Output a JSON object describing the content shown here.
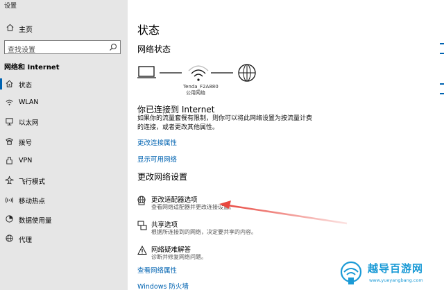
{
  "window": {
    "title": "设置"
  },
  "sidebar": {
    "home_label": "主页",
    "search_placeholder": "查找设置",
    "section_title": "网络和 Internet",
    "items": [
      {
        "label": "状态",
        "icon": "home-network-icon",
        "active": true
      },
      {
        "label": "WLAN",
        "icon": "wifi-icon",
        "active": false
      },
      {
        "label": "以太网",
        "icon": "ethernet-icon",
        "active": false
      },
      {
        "label": "拨号",
        "icon": "dialup-icon",
        "active": false
      },
      {
        "label": "VPN",
        "icon": "vpn-icon",
        "active": false
      },
      {
        "label": "飞行模式",
        "icon": "airplane-icon",
        "active": false
      },
      {
        "label": "移动热点",
        "icon": "hotspot-icon",
        "active": false
      },
      {
        "label": "数据使用量",
        "icon": "data-usage-icon",
        "active": false
      },
      {
        "label": "代理",
        "icon": "globe-icon",
        "active": false
      }
    ]
  },
  "main": {
    "title": "状态",
    "network_status_heading": "网络状态",
    "network_name": "Tenda_F2A880",
    "network_type": "公用网络",
    "connected_text": "你已连接到 Internet",
    "description": "如果你的流量套餐有限制，则你可以将此网络设置为按流量计费的连接，或者更改其他属性。",
    "links": {
      "change_connection_properties": "更改连接属性",
      "show_available_networks": "显示可用网络"
    },
    "change_settings_heading": "更改网络设置",
    "options": [
      {
        "title": "更改适配器选项",
        "desc": "查看网络适配器并更改连接设置。",
        "icon": "adapter-icon"
      },
      {
        "title": "共享选项",
        "desc": "根据所连接到的网络，决定要共享的内容。",
        "icon": "sharing-icon"
      },
      {
        "title": "网络疑难解答",
        "desc": "诊断并修复网络问题。",
        "icon": "warning-icon"
      }
    ],
    "bottom_links": {
      "view_network_properties": "查看网络属性",
      "windows_firewall": "Windows 防火墙"
    }
  },
  "watermark": {
    "title": "越导百游网",
    "url": "www.yueyangbang.com"
  },
  "colors": {
    "sidebar_bg": "#e6e6e6",
    "accent": "#0063b1",
    "arrow": "#e8473f",
    "watermark": "#1a9ad6"
  }
}
